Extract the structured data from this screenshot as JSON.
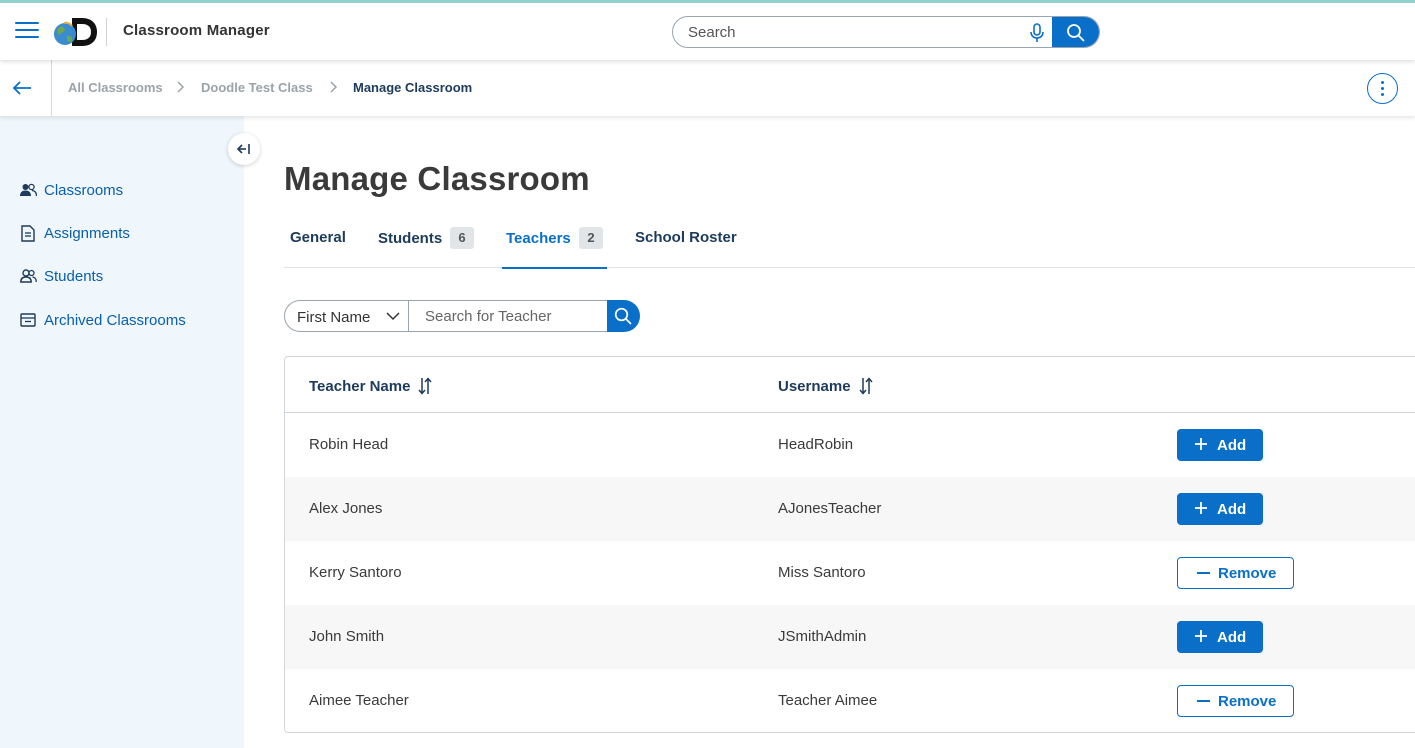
{
  "header": {
    "app_title": "Classroom Manager",
    "search_placeholder": "Search"
  },
  "breadcrumb": {
    "items": [
      "All Classrooms",
      "Doodle Test Class",
      "Manage Classroom"
    ]
  },
  "sidebar": {
    "items": [
      {
        "label": "Classrooms",
        "icon": "classrooms-icon"
      },
      {
        "label": "Assignments",
        "icon": "document-icon"
      },
      {
        "label": "Students",
        "icon": "people-icon"
      },
      {
        "label": "Archived Classrooms",
        "icon": "archive-icon"
      }
    ]
  },
  "main": {
    "title": "Manage Classroom",
    "tabs": [
      {
        "label": "General",
        "count": null,
        "active": false
      },
      {
        "label": "Students",
        "count": "6",
        "active": false
      },
      {
        "label": "Teachers",
        "count": "2",
        "active": true
      },
      {
        "label": "School Roster",
        "count": null,
        "active": false
      }
    ],
    "filter": {
      "field": "First Name",
      "placeholder": "Search for Teacher"
    },
    "table": {
      "columns": [
        "Teacher Name",
        "Username"
      ],
      "rows": [
        {
          "name": "Robin Head",
          "username": "HeadRobin",
          "action": "Add"
        },
        {
          "name": "Alex Jones",
          "username": "AJonesTeacher",
          "action": "Add"
        },
        {
          "name": "Kerry Santoro",
          "username": "Miss Santoro",
          "action": "Remove"
        },
        {
          "name": "John Smith",
          "username": "JSmithAdmin",
          "action": "Add"
        },
        {
          "name": "Aimee Teacher",
          "username": "Teacher Aimee",
          "action": "Remove"
        }
      ]
    }
  },
  "colors": {
    "accent": "#0a6fc9",
    "sidebar_bg": "#eff6fc",
    "heading": "#1d3b5a"
  }
}
